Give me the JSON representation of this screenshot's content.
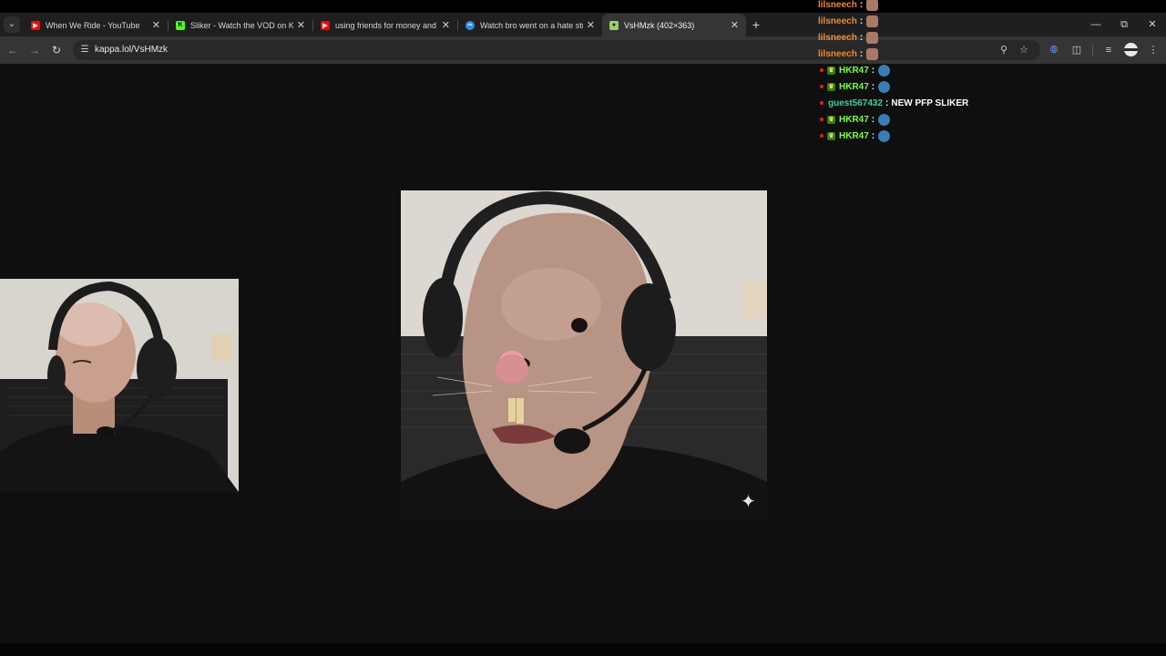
{
  "browser": {
    "tabs": [
      {
        "title": "When We Ride - YouTube",
        "favicon": "youtube-icon",
        "favicon_color": "#ff0000",
        "active": false
      },
      {
        "title": "Sliker - Watch the VOD on Kick",
        "favicon": "kick-icon",
        "favicon_color": "#53fc18",
        "active": false
      },
      {
        "title": "using friends for money and ex",
        "favicon": "youtube-icon",
        "favicon_color": "#ff0000",
        "active": false
      },
      {
        "title": "Watch bro went on a hate strea",
        "favicon": "streamable-icon",
        "favicon_color": "#2d8ceb",
        "active": false
      },
      {
        "title": "VsHMzk (402×363)",
        "favicon": "kappa-icon",
        "favicon_color": "#9bcf6a",
        "active": true
      }
    ],
    "url": "kappa.lol/VsHMzk"
  },
  "chat": {
    "messages": [
      {
        "user": "lilsneech",
        "user_color": "#f08a2a",
        "text": "",
        "emote": "face",
        "badges": false
      },
      {
        "user": "lilsneech",
        "user_color": "#f08a2a",
        "text": "",
        "emote": "face",
        "badges": false
      },
      {
        "user": "lilsneech",
        "user_color": "#f08a2a",
        "text": "",
        "emote": "face",
        "badges": false
      },
      {
        "user": "lilsneech",
        "user_color": "#f08a2a",
        "text": "",
        "emote": "face",
        "badges": false
      },
      {
        "user": "HKR47",
        "user_color": "#7cff3a",
        "text": "",
        "emote": "pepe",
        "badges": true
      },
      {
        "user": "HKR47",
        "user_color": "#7cff3a",
        "text": "",
        "emote": "pepe",
        "badges": true
      },
      {
        "user": "guest567432",
        "user_color": "#3ad1a0",
        "text": "NEW PFP SLIKER",
        "emote": "",
        "badges": false,
        "dot": true
      },
      {
        "user": "HKR47",
        "user_color": "#7cff3a",
        "text": "",
        "emote": "pepe",
        "badges": true
      },
      {
        "user": "HKR47",
        "user_color": "#7cff3a",
        "text": "",
        "emote": "pepe",
        "badges": true
      }
    ],
    "separator": ":"
  }
}
